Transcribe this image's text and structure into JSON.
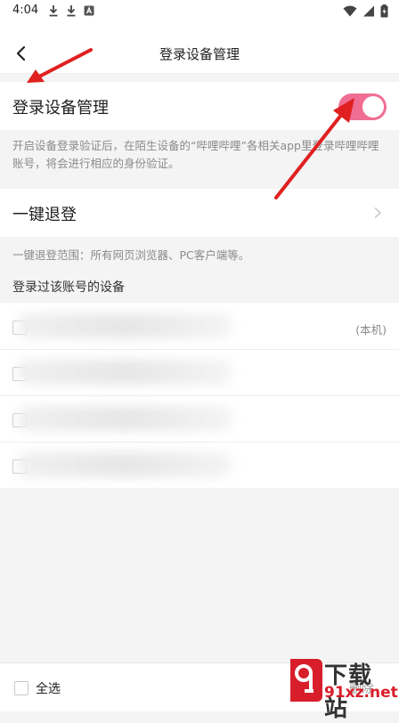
{
  "status_bar": {
    "time": "4:04"
  },
  "nav": {
    "title": "登录设备管理"
  },
  "login_management": {
    "label": "登录设备管理",
    "enabled": true,
    "description": "开启设备登录验证后，在陌生设备的“哔哩哔哩”各相关app里登录哔哩哔哩账号，将会进行相应的身份验证。"
  },
  "logout_all": {
    "label": "一键退登",
    "scope": "一键退登范围：所有网页浏览器、PC客户端等。"
  },
  "devices": {
    "heading": "登录过该账号的设备",
    "current_label": "(本机)"
  },
  "bottom_bar": {
    "select_all": "全选",
    "delete": "删除"
  },
  "watermark": {
    "text": "下载站",
    "url": "91xz.net"
  },
  "colors": {
    "accent": "#f06d94",
    "annotation": "#e02020",
    "watermark_red": "#d81e2b"
  }
}
